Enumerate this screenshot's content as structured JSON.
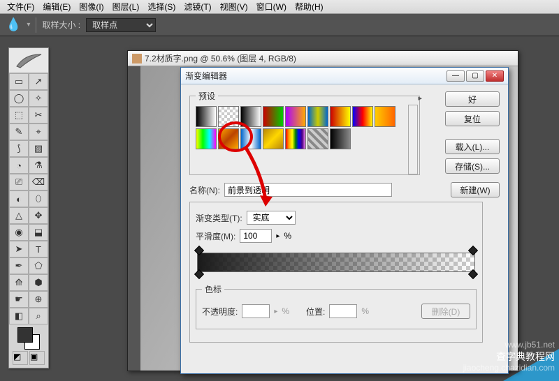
{
  "menu": {
    "items": [
      "文件(F)",
      "编辑(E)",
      "图像(I)",
      "图层(L)",
      "选择(S)",
      "滤镜(T)",
      "视图(V)",
      "窗口(W)",
      "帮助(H)"
    ]
  },
  "options": {
    "sample_label": "取样大小 :",
    "sample_value": "取样点",
    "eyedropper_icon": "eyedropper"
  },
  "document": {
    "title": "7.2材质字.png @ 50.6% (图层 4, RGB/8)"
  },
  "dialog": {
    "title": "渐变编辑器",
    "presets_label": "预设",
    "buttons": {
      "ok": "好",
      "reset": "复位",
      "load": "载入(L)...",
      "save": "存储(S)...",
      "new": "新建(W)"
    },
    "name_label": "名称(N):",
    "name_value": "前景到透明",
    "type_label": "渐变类型(T):",
    "type_value": "实底",
    "smooth_label": "平滑度(M):",
    "smooth_value": "100",
    "smooth_unit": "%",
    "stops_label": "色标",
    "opacity_label": "不透明度:",
    "position_label": "位置:",
    "delete_label": "删除(D)",
    "unit": "%",
    "preset_swatches": [
      "linear-gradient(to right,#000,#fff)",
      "repeating-conic-gradient(#ccc 0 25%,#fff 0 50%) 0 0/8px 8px",
      "linear-gradient(to right,#000,#fff)",
      "linear-gradient(to right,#c00,#0c0)",
      "linear-gradient(to right,#a0f,#fa0)",
      "linear-gradient(to right,#06c,#cc0,#06c)",
      "linear-gradient(to right,#c00,#ff0)",
      "linear-gradient(to right,#00f,#f00,#ff0)",
      "linear-gradient(to right,#fc0,#f60)",
      "linear-gradient(to right,#ff0,#0f0,#0ff,#f0f)",
      "linear-gradient(135deg,#fa0,#b40,#fa0)",
      "linear-gradient(to right,#06c,#fff,#06c)",
      "linear-gradient(135deg,#b8860b,#ffd700,#b8860b)",
      "linear-gradient(to right,red,orange,yellow,green,blue,indigo,violet)",
      "repeating-linear-gradient(45deg,#888 0 4px,#ccc 4px 8px)",
      "linear-gradient(to right,#000,#888)"
    ]
  },
  "tools": [
    "▭",
    "↗",
    "◯",
    "✧",
    "⬚",
    "✂",
    "✎",
    "⌖",
    "⟆",
    "▨",
    "◔",
    "⚗",
    "⎚",
    "⌫",
    "◐",
    "⬯",
    "△",
    "✥",
    "◉",
    "⬓",
    "➤",
    "T",
    "✒",
    "⬠",
    "⟰",
    "⬢",
    "☛",
    "⊕",
    "◧",
    "⌕"
  ],
  "watermark": {
    "line1": "www.jb51.net",
    "line2": "查字典教程网",
    "line3": "jiaocheng.chazidian.com"
  }
}
